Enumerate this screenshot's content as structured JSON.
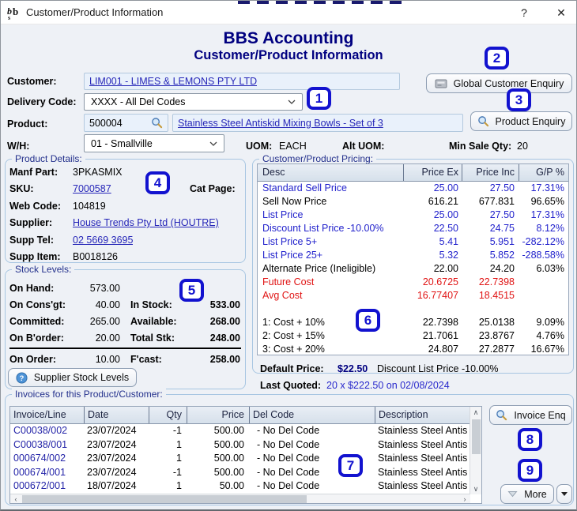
{
  "window": {
    "title": "Customer/Product Information",
    "help_label": "?",
    "close_label": "✕"
  },
  "header": {
    "app": "BBS Accounting",
    "screen": "Customer/Product Information"
  },
  "form": {
    "customer_label": "Customer:",
    "customer_value": "LIM001 - LIMES & LEMONS PTY LTD",
    "delivery_label": "Delivery Code:",
    "delivery_value": "XXXX - All Del Codes",
    "product_label": "Product:",
    "product_code": "500004",
    "product_desc": "Stainless Steel Antiskid Mixing Bowls - Set of 3",
    "wh_label": "W/H:",
    "wh_value": "01 - Smallville",
    "uom_label": "UOM:",
    "uom_value": "EACH",
    "alt_uom_label": "Alt UOM:",
    "alt_uom_value": "",
    "min_sale_label": "Min Sale Qty:",
    "min_sale_value": "20"
  },
  "buttons": {
    "global_customer_enquiry": "Global Customer Enquiry",
    "product_enquiry": "Product Enquiry",
    "supplier_stock_levels": "Supplier Stock Levels",
    "invoice_enq": "Invoice Enq",
    "more": "More"
  },
  "product_details": {
    "title": "Product Details:",
    "manf_part_label": "Manf Part:",
    "manf_part": "3PKASMIX",
    "sku_label": "SKU:",
    "sku": "7000587",
    "cat_page_label": "Cat Page:",
    "cat_page": "",
    "web_code_label": "Web Code:",
    "web_code": "104819",
    "supplier_label": "Supplier:",
    "supplier": "House Trends Pty Ltd (HOUTRE)",
    "supp_tel_label": "Supp Tel:",
    "supp_tel": "02 5669 3695",
    "supp_item_label": "Supp Item:",
    "supp_item": "B0018126"
  },
  "pricing": {
    "title": "Customer/Product Pricing:",
    "columns": [
      "Desc",
      "Price Ex",
      "Price Inc",
      "G/P %"
    ],
    "rows": [
      {
        "desc": "Standard Sell Price",
        "ex": "25.00",
        "inc": "27.50",
        "gp": "17.31%",
        "cls": "blue"
      },
      {
        "desc": "Sell Now Price",
        "ex": "616.21",
        "inc": "677.831",
        "gp": "96.65%",
        "cls": ""
      },
      {
        "desc": "List Price",
        "ex": "25.00",
        "inc": "27.50",
        "gp": "17.31%",
        "cls": "blue"
      },
      {
        "desc": "Discount List Price -10.00%",
        "ex": "22.50",
        "inc": "24.75",
        "gp": "8.12%",
        "cls": "blue"
      },
      {
        "desc": "List Price 5+",
        "ex": "5.41",
        "inc": "5.951",
        "gp": "-282.12%",
        "cls": "blue"
      },
      {
        "desc": "List Price 25+",
        "ex": "5.32",
        "inc": "5.852",
        "gp": "-288.58%",
        "cls": "blue"
      },
      {
        "desc": "Alternate Price (Ineligible)",
        "ex": "22.00",
        "inc": "24.20",
        "gp": "6.03%",
        "cls": ""
      },
      {
        "desc": "Future Cost",
        "ex": "20.6725",
        "inc": "22.7398",
        "gp": "",
        "cls": "red"
      },
      {
        "desc": "Avg Cost",
        "ex": "16.77407",
        "inc": "18.4515",
        "gp": "",
        "cls": "red"
      },
      {
        "desc": "",
        "ex": "",
        "inc": "",
        "gp": "",
        "cls": "spacer"
      },
      {
        "desc": "1: Cost + 10%",
        "ex": "22.7398",
        "inc": "25.0138",
        "gp": "9.09%",
        "cls": ""
      },
      {
        "desc": "2: Cost + 15%",
        "ex": "21.7061",
        "inc": "23.8767",
        "gp": "4.76%",
        "cls": ""
      },
      {
        "desc": "3: Cost + 20%",
        "ex": "24.807",
        "inc": "27.2877",
        "gp": "16.67%",
        "cls": ""
      }
    ]
  },
  "price_summary": {
    "default_label": "Default Price:",
    "default_value": "$22.50",
    "default_desc": "Discount List Price -10.00%",
    "last_quoted_label": "Last Quoted:",
    "last_quoted_value": "20 x $222.50 on 02/08/2024"
  },
  "stock": {
    "title": "Stock Levels:",
    "rows_left": [
      {
        "label": "On Hand:",
        "value": "573.00"
      },
      {
        "label": "On Cons'gt:",
        "value": "40.00"
      },
      {
        "label": "Committed:",
        "value": "265.00"
      },
      {
        "label": "On B'order:",
        "value": "20.00"
      },
      {
        "label": "On Order:",
        "value": "10.00"
      }
    ],
    "rows_right": [
      {
        "label": "In Stock:",
        "value": "533.00"
      },
      {
        "label": "Available:",
        "value": "268.00"
      },
      {
        "label": "Total Stk:",
        "value": "248.00"
      },
      {
        "label": "F'cast:",
        "value": "258.00"
      }
    ]
  },
  "invoices": {
    "title": "Invoices for this Product/Customer:",
    "columns": [
      "Invoice/Line",
      "Date",
      "Qty",
      "Price",
      "Del Code",
      "Description"
    ],
    "rows": [
      {
        "inv": "C00038/002",
        "date": "23/07/2024",
        "qty": "-1",
        "price": "500.00",
        "del": "- No Del Code",
        "idesc": "Stainless Steel Antis"
      },
      {
        "inv": "C00038/001",
        "date": "23/07/2024",
        "qty": "1",
        "price": "500.00",
        "del": "- No Del Code",
        "idesc": "Stainless Steel Antis"
      },
      {
        "inv": "000674/002",
        "date": "23/07/2024",
        "qty": "1",
        "price": "500.00",
        "del": "- No Del Code",
        "idesc": "Stainless Steel Antis"
      },
      {
        "inv": "000674/001",
        "date": "23/07/2024",
        "qty": "-1",
        "price": "500.00",
        "del": "- No Del Code",
        "idesc": "Stainless Steel Antis"
      },
      {
        "inv": "000672/001",
        "date": "18/07/2024",
        "qty": "1",
        "price": "50.00",
        "del": "- No Del Code",
        "idesc": "Stainless Steel Antis"
      }
    ]
  },
  "callouts": [
    "1",
    "2",
    "3",
    "4",
    "5",
    "6",
    "7",
    "8",
    "9"
  ],
  "colors": {
    "accent_navy": "#000080",
    "callout_blue": "#1212cf",
    "link_blue": "#2626b8",
    "price_blue": "#2222cc",
    "cost_red": "#e01414",
    "field_bg": "#e9f1fb"
  }
}
